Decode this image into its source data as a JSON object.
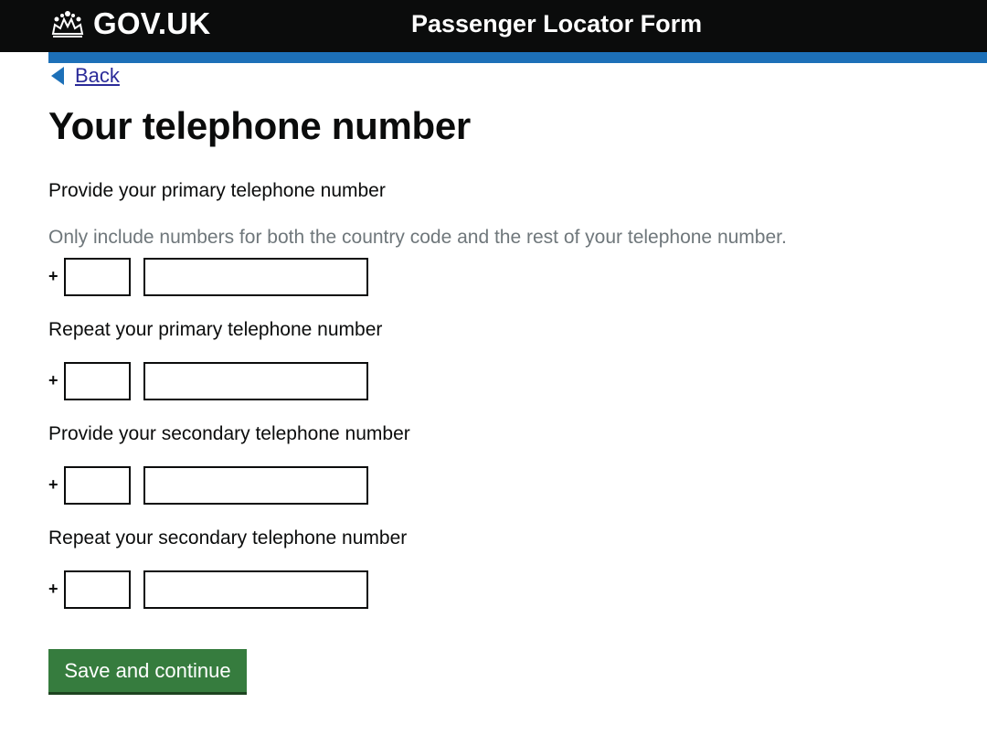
{
  "header": {
    "logo_text": "GOV.UK",
    "service_name": "Passenger Locator Form",
    "colors": {
      "background": "#0b0c0c",
      "accent_bar": "#1d70b8"
    }
  },
  "back_link": {
    "label": "Back"
  },
  "page": {
    "title": "Your telephone number"
  },
  "fields": {
    "primary": {
      "label": "Provide your primary telephone number",
      "hint": "Only include numbers for both the country code and the rest of your telephone number.",
      "prefix": "+",
      "country_code_value": "",
      "number_value": ""
    },
    "primary_repeat": {
      "label": "Repeat your primary telephone number",
      "prefix": "+",
      "country_code_value": "",
      "number_value": ""
    },
    "secondary": {
      "label": "Provide your secondary telephone number",
      "prefix": "+",
      "country_code_value": "",
      "number_value": ""
    },
    "secondary_repeat": {
      "label": "Repeat your secondary telephone number",
      "prefix": "+",
      "country_code_value": "",
      "number_value": ""
    }
  },
  "actions": {
    "submit_label": "Save and continue",
    "submit_color": "#367c3e"
  },
  "icons": {
    "logo": "crown-icon",
    "back": "triangle-left-icon"
  }
}
